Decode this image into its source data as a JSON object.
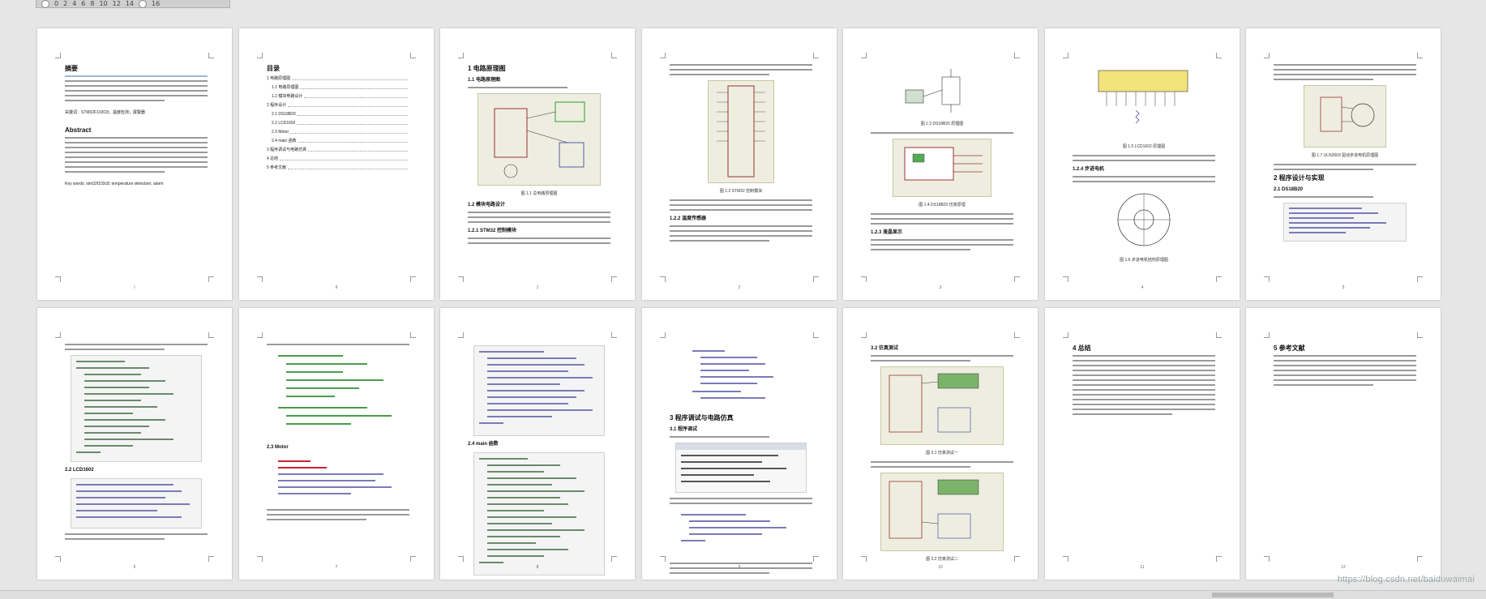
{
  "zoom_bar": {
    "ticks": [
      "0",
      "2",
      "4",
      "6",
      "8",
      "10",
      "12",
      "14",
      "16"
    ]
  },
  "watermark": "https://blog.csdn.net/baiduwaimai",
  "pages_row1": [
    {
      "id": "p1",
      "heading": "摘要",
      "keywords": "关键词：STM32F103C8；温度检测；报警器",
      "abstract_en": "Abstract",
      "keywords_en": "Key words: stm32f103c8; temperature detection; alarm",
      "num": "I"
    },
    {
      "id": "p2",
      "heading": "目录",
      "toc": [
        "1 电路原理图",
        "1.1 电路原理图",
        "1.2 模块电路设计",
        "2 程序设计",
        "2.1 DS18B20",
        "2.2 LCD1602",
        "2.3 Motor",
        "2.4 main 函数",
        "3 程序调试与电路仿真",
        "4 总结",
        "5 参考文献"
      ],
      "num": "II"
    },
    {
      "id": "p3",
      "heading": "1 电路原理图",
      "sub1": "1.1 电路原理图",
      "cap1": "图 1.1 总电路原理图",
      "sub2": "1.2 模块电路设计",
      "sub3": "1.2.1 STM32 控制模块",
      "num": "1"
    },
    {
      "id": "p4",
      "cap1": "图 1.2 STM32 控制模块",
      "sub1": "1.2.2 温度传感器",
      "num": "2"
    },
    {
      "id": "p5",
      "cap1": "图 1.3 DS18B20 原理图",
      "cap2": "图 1.4 DS18B20 仿真原理",
      "sub1": "1.2.3 液晶显示",
      "num": "3"
    },
    {
      "id": "p6",
      "cap1": "图 1.5 LCD1602 原理图",
      "sub1": "1.2.4 步进电机",
      "cap2": "图 1.6 步进电机结构原理图",
      "num": "4"
    },
    {
      "id": "p7",
      "cap1": "图 1.7 ULN2003 驱动步进电机原理图",
      "sub1": "2 程序设计与实现",
      "sub2": "2.1 DS18B20",
      "num": "5"
    }
  ],
  "pages_row2": [
    {
      "id": "p8",
      "sub1": "2.2 LCD1602",
      "num": "6"
    },
    {
      "id": "p9",
      "sub1": "2.3 Motor",
      "num": "7"
    },
    {
      "id": "p10",
      "sub1": "2.4 main 函数",
      "num": "8"
    },
    {
      "id": "p11",
      "sub1": "3 程序调试与电路仿真",
      "sub2": "3.1 程序调试",
      "num": "9"
    },
    {
      "id": "p12",
      "sub1": "3.2 仿真测试",
      "cap1": "图 3.1 仿真测试一",
      "cap2": "图 3.2 仿真测试二",
      "num": "10"
    },
    {
      "id": "p13",
      "sub1": "4 总结",
      "num": "11"
    },
    {
      "id": "p14",
      "sub1": "5 参考文献",
      "num": "12"
    }
  ]
}
